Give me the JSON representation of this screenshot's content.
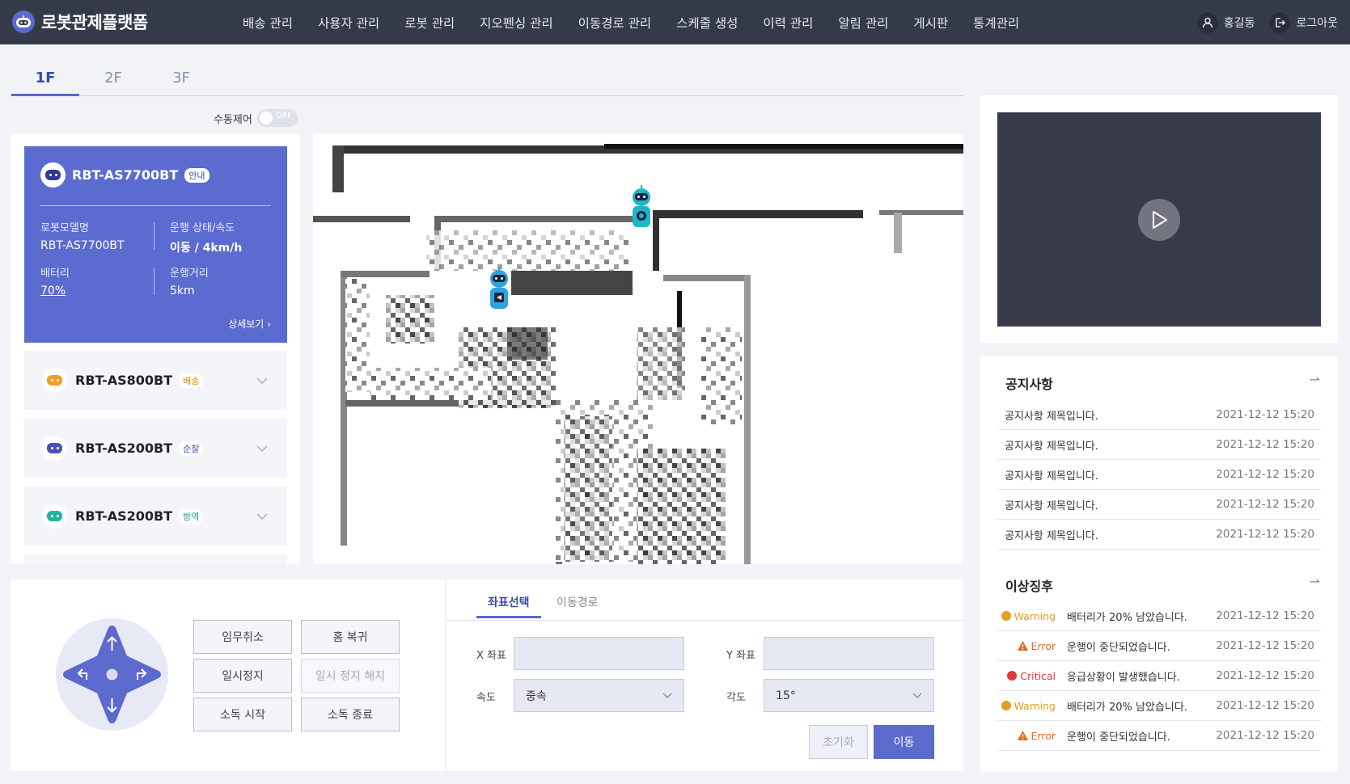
{
  "app": {
    "title": "로봇관제플랫폼"
  },
  "nav": [
    "배송 관리",
    "사용자 관리",
    "로봇 관리",
    "지오펜싱 관리",
    "이동경로 관리",
    "스케줄 생성",
    "이력 관리",
    "알림 관리",
    "게시판",
    "통계관리"
  ],
  "user": {
    "name": "홍길동",
    "logout": "로그아웃"
  },
  "floors": [
    "1F",
    "2F",
    "3F"
  ],
  "manual_control": {
    "label": "수동제어",
    "state": "OFF"
  },
  "robots": [
    {
      "name": "RBT-AS7700BT",
      "tag": "안내",
      "color": "#2f3b8f",
      "tag_color": "#3a4aa8",
      "model_label": "로봇모델명",
      "model": "RBT-AS7700BT",
      "status_label": "운행 상태/속도",
      "status": "이동 / 4km/h",
      "battery_label": "배터리",
      "battery": "70%",
      "distance_label": "운행거리",
      "distance": "5km",
      "detail": "상세보기"
    },
    {
      "name": "RBT-AS800BT",
      "tag": "배송",
      "color": "#f0a020",
      "tag_color": "#e08a00"
    },
    {
      "name": "RBT-AS200BT",
      "tag": "순찰",
      "color": "#4a4fb8",
      "tag_color": "#4a4fb8"
    },
    {
      "name": "RBT-AS200BT",
      "tag": "방역",
      "color": "#1fb59c",
      "tag_color": "#14a088"
    }
  ],
  "notices": {
    "title": "공지사항",
    "items": [
      {
        "text": "공지사항 제목입니다.",
        "date": "2021-12-12 15:20"
      },
      {
        "text": "공지사항 제목입니다.",
        "date": "2021-12-12 15:20"
      },
      {
        "text": "공지사항 제목입니다.",
        "date": "2021-12-12 15:20"
      },
      {
        "text": "공지사항 제목입니다.",
        "date": "2021-12-12 15:20"
      },
      {
        "text": "공지사항 제목입니다.",
        "date": "2021-12-12 15:20"
      }
    ]
  },
  "anomalies": {
    "title": "이상징후",
    "items": [
      {
        "level": "Warning",
        "msg": "배터리가 20% 남았습니다.",
        "date": "2021-12-12 15:20",
        "color": "#e0a020",
        "icon": "warning-dot-icon"
      },
      {
        "level": "Error",
        "msg": "운행이 중단되었습니다.",
        "date": "2021-12-12 15:20",
        "color": "#e06a20",
        "icon": "error-triangle-icon"
      },
      {
        "level": "Critical",
        "msg": "응급상황이 발생했습니다.",
        "date": "2021-12-12 15:20",
        "color": "#e03a3a",
        "icon": "critical-dot-icon"
      },
      {
        "level": "Warning",
        "msg": "배터리가 20% 남았습니다.",
        "date": "2021-12-12 15:20",
        "color": "#e0a020",
        "icon": "warning-dot-icon"
      },
      {
        "level": "Error",
        "msg": "운행이 중단되었습니다.",
        "date": "2021-12-12 15:20",
        "color": "#e06a20",
        "icon": "error-triangle-icon"
      }
    ]
  },
  "controls": {
    "buttons": [
      "임무취소",
      "홈 복귀",
      "일시정지",
      "일시 정지 해지",
      "소독 시작",
      "소독 종료"
    ]
  },
  "coords": {
    "tabs": [
      "좌표선택",
      "이동경로"
    ],
    "x_label": "X 좌표",
    "x_value": "",
    "y_label": "Y 좌표",
    "y_value": "",
    "speed_label": "속도",
    "speed_value": "중속",
    "angle_label": "각도",
    "angle_value": "15°",
    "reset": "초기화",
    "move": "이동"
  },
  "colors": {
    "accent": "#5b6acc",
    "header": "#353a48",
    "robot_teal": "#1fb5c8"
  }
}
